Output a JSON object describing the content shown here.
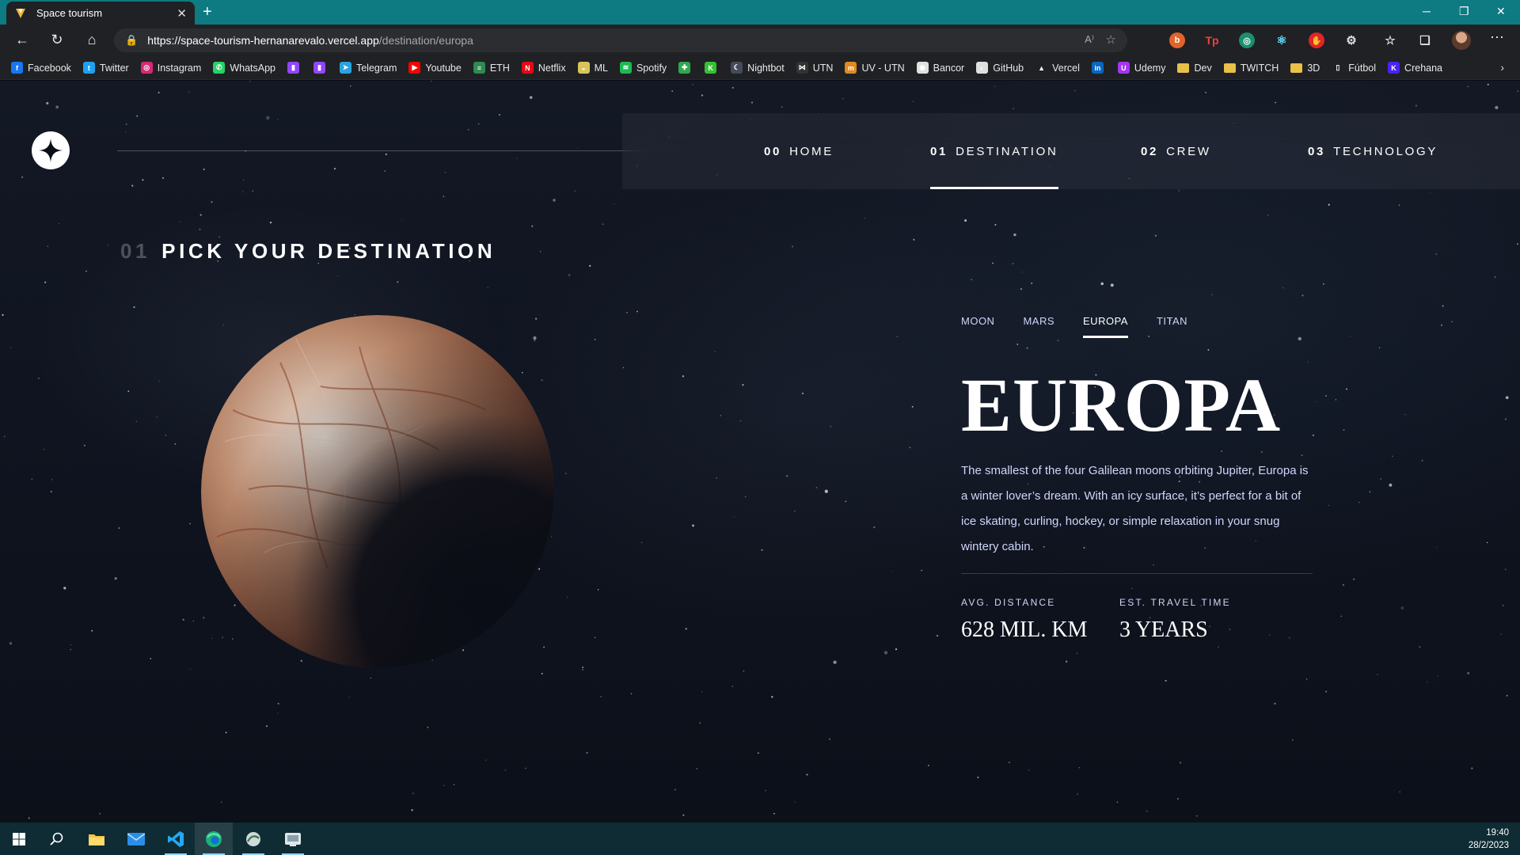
{
  "browser": {
    "tab_title": "Space tourism",
    "tab_close": "✕",
    "new_tab": "+",
    "url_host": "https://space-tourism-hernanarevalo.vercel.app",
    "url_path": "/destination/europa",
    "read_aloud": "A⁾",
    "favorite": "☆",
    "window_controls": [
      "─",
      "❐",
      "✕"
    ],
    "menu": "⋯"
  },
  "bookmarks": [
    {
      "label": "Facebook",
      "icon": "facebook-icon",
      "color": "#1877f2",
      "glyph": "f"
    },
    {
      "label": "Twitter",
      "icon": "twitter-icon",
      "color": "#1da1f2",
      "glyph": "t"
    },
    {
      "label": "Instagram",
      "icon": "instagram-icon",
      "color": "#d62976",
      "glyph": "◎"
    },
    {
      "label": "WhatsApp",
      "icon": "whatsapp-icon",
      "color": "#25d366",
      "glyph": "✆"
    },
    {
      "label": "",
      "icon": "twitch-icon",
      "color": "#9146ff",
      "glyph": "▮"
    },
    {
      "label": "",
      "icon": "twitch-icon",
      "color": "#9146ff",
      "glyph": "▮"
    },
    {
      "label": "Telegram",
      "icon": "telegram-icon",
      "color": "#2aa3de",
      "glyph": "➤"
    },
    {
      "label": "Youtube",
      "icon": "youtube-icon",
      "color": "#ff0000",
      "glyph": "▶"
    },
    {
      "label": "ETH",
      "icon": "eth-icon",
      "color": "#2f8a55",
      "glyph": "≡"
    },
    {
      "label": "Netflix",
      "icon": "netflix-icon",
      "color": "#e50914",
      "glyph": "N"
    },
    {
      "label": "ML",
      "icon": "mercadolibre-icon",
      "color": "#d8c45a",
      "glyph": "◒"
    },
    {
      "label": "Spotify",
      "icon": "spotify-icon",
      "color": "#1db954",
      "glyph": "≋"
    },
    {
      "label": "",
      "icon": "puzzle-icon",
      "color": "#2fa84f",
      "glyph": "✚"
    },
    {
      "label": "",
      "icon": "kick-icon",
      "color": "#35c035",
      "glyph": "K"
    },
    {
      "label": "Nightbot",
      "icon": "nightbot-icon",
      "color": "#444a5a",
      "glyph": "☾"
    },
    {
      "label": "UTN",
      "icon": "utn-icon",
      "color": "#333333",
      "glyph": "⋈"
    },
    {
      "label": "UV - UTN",
      "icon": "moodle-icon",
      "color": "#e08a1e",
      "glyph": "m"
    },
    {
      "label": "Bancor",
      "icon": "bancor-icon",
      "color": "#e0e0e0",
      "glyph": "◉"
    },
    {
      "label": "GitHub",
      "icon": "github-icon",
      "color": "#e0e0e0",
      "glyph": "◐"
    },
    {
      "label": "Vercel",
      "icon": "vercel-icon",
      "color": "#202124",
      "glyph": "▲"
    },
    {
      "label": "",
      "icon": "linkedin-icon",
      "color": "#0a66c2",
      "glyph": "in"
    },
    {
      "label": "Udemy",
      "icon": "udemy-icon",
      "color": "#a435f0",
      "glyph": "U"
    },
    {
      "label": "Dev",
      "icon": "folder-icon",
      "color": "#e8c04a",
      "glyph": ""
    },
    {
      "label": "TWITCH",
      "icon": "folder-icon",
      "color": "#e8c04a",
      "glyph": ""
    },
    {
      "label": "3D",
      "icon": "folder-icon",
      "color": "#e8c04a",
      "glyph": ""
    },
    {
      "label": "Fútbol",
      "icon": "page-icon",
      "color": "#202124",
      "glyph": "▯"
    },
    {
      "label": "Crehana",
      "icon": "crehana-icon",
      "color": "#4b22f4",
      "glyph": "K"
    }
  ],
  "bookmarks_more": "›",
  "nav": [
    {
      "num": "00",
      "label": "HOME",
      "active": false
    },
    {
      "num": "01",
      "label": "DESTINATION",
      "active": true
    },
    {
      "num": "02",
      "label": "CREW",
      "active": false
    },
    {
      "num": "03",
      "label": "TECHNOLOGY",
      "active": false
    }
  ],
  "heading": {
    "num": "01",
    "text": "PICK YOUR DESTINATION"
  },
  "destinations": [
    {
      "label": "MOON",
      "active": false
    },
    {
      "label": "MARS",
      "active": false
    },
    {
      "label": "EUROPA",
      "active": true
    },
    {
      "label": "TITAN",
      "active": false
    }
  ],
  "destination": {
    "name": "EUROPA",
    "description": "The smallest of the four Galilean moons orbiting Jupiter, Europa is a winter lover’s dream. With an icy surface, it’s perfect for a bit of ice skating, curling, hockey, or simple relaxation in your snug wintery cabin.",
    "distance_label": "AVG. DISTANCE",
    "distance_value": "628 MIL. KM",
    "travel_label": "EST. TRAVEL TIME",
    "travel_value": "3 YEARS"
  },
  "taskbar": {
    "time": "19:40",
    "date": "28/2/2023"
  }
}
